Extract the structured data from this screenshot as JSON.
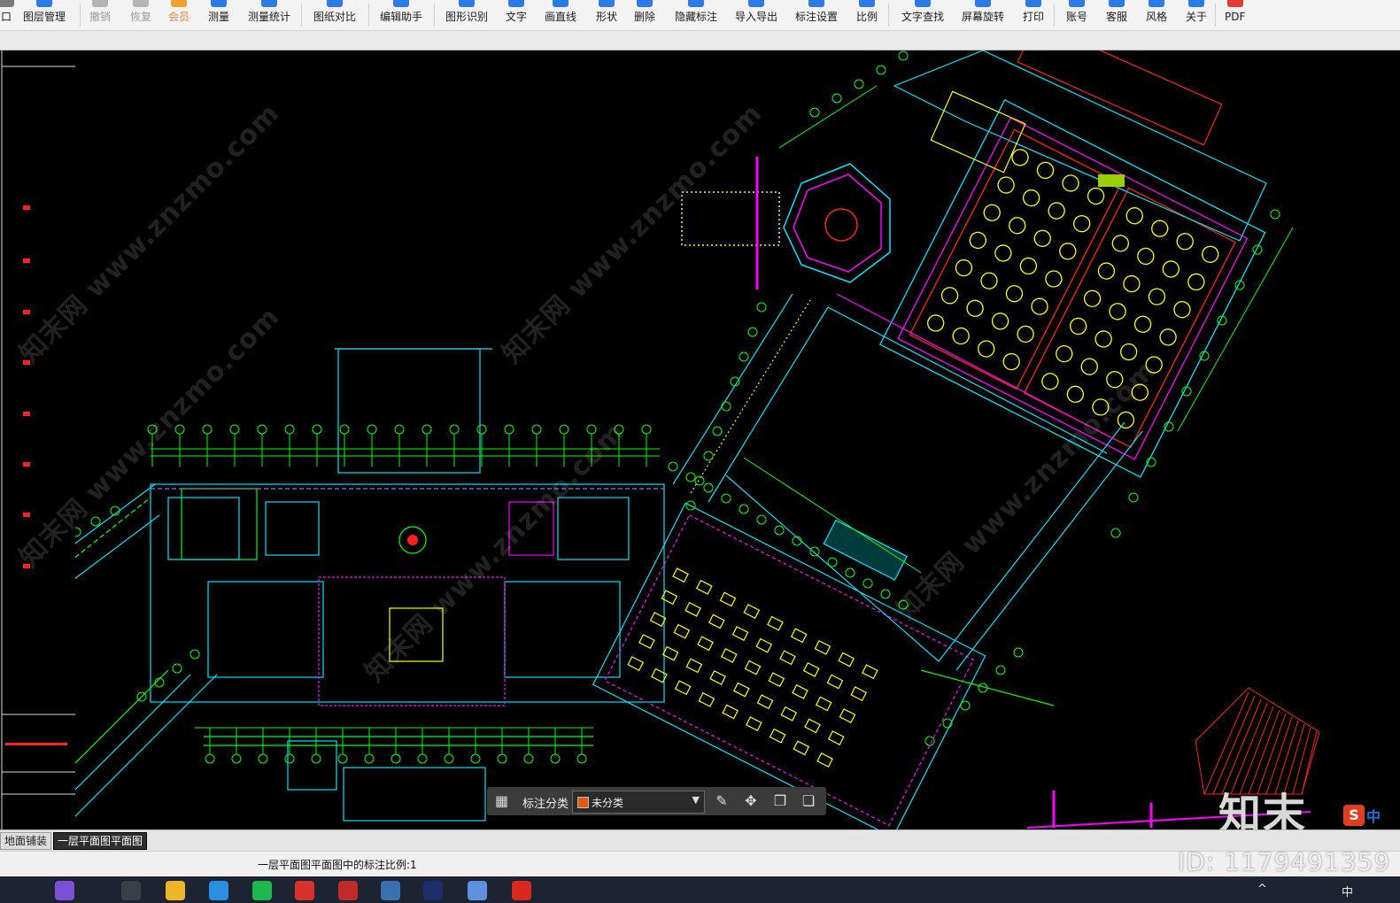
{
  "toolbar": {
    "items": [
      {
        "label": "口",
        "state": "normal"
      },
      {
        "label": "图层管理",
        "state": "normal"
      },
      {
        "label": "撤销",
        "state": "disabled"
      },
      {
        "label": "恢复",
        "state": "disabled"
      },
      {
        "label": "会员",
        "state": "accent"
      },
      {
        "label": "测量",
        "state": "normal"
      },
      {
        "label": "测量统计",
        "state": "normal"
      },
      {
        "label": "图纸对比",
        "state": "normal"
      },
      {
        "label": "编辑助手",
        "state": "normal"
      },
      {
        "label": "图形识别",
        "state": "normal"
      },
      {
        "label": "文字",
        "state": "normal"
      },
      {
        "label": "画直线",
        "state": "normal"
      },
      {
        "label": "形状",
        "state": "normal"
      },
      {
        "label": "删除",
        "state": "normal"
      },
      {
        "label": "隐藏标注",
        "state": "normal"
      },
      {
        "label": "导入导出",
        "state": "normal"
      },
      {
        "label": "标注设置",
        "state": "normal"
      },
      {
        "label": "比例",
        "state": "normal"
      },
      {
        "label": "文字查找",
        "state": "normal"
      },
      {
        "label": "屏幕旋转",
        "state": "normal"
      },
      {
        "label": "打印",
        "state": "normal"
      },
      {
        "label": "账号",
        "state": "normal"
      },
      {
        "label": "客服",
        "state": "normal"
      },
      {
        "label": "风格",
        "state": "normal"
      },
      {
        "label": "关于",
        "state": "normal"
      },
      {
        "label": "PDF",
        "state": "normal"
      }
    ],
    "icons": [
      "window-icon",
      "layers-icon",
      "undo-icon",
      "redo-icon",
      "vip-icon",
      "ruler-icon",
      "measure-stats-icon",
      "compare-icon",
      "edit-helper-icon",
      "shape-recognize-icon",
      "text-icon",
      "line-icon",
      "shape-icon",
      "delete-icon",
      "hide-annotation-icon",
      "import-export-icon",
      "annotation-settings-icon",
      "scale-icon",
      "text-search-icon",
      "screen-rotate-icon",
      "print-icon",
      "account-icon",
      "support-icon",
      "theme-icon",
      "about-icon",
      "pdf-icon"
    ]
  },
  "colors": {
    "accent": "#e8863a",
    "cad_green": "#00ff00",
    "cad_cyan": "#00e5ff",
    "cad_yellow": "#ffff00",
    "cad_magenta": "#ff00ff",
    "cad_red": "#ff2020",
    "annotation_swatch": "#e55a13"
  },
  "watermarks": [
    "知末网 www.znzmo.com",
    "知末网 www.znzmo.com",
    "知末网 www.znzmo.com",
    "知末网 www.znzmo.com",
    "知末网 www.znzmo.com"
  ],
  "annotation_bar": {
    "label": "标注分类",
    "selected": "未分类",
    "icons": [
      "grid-icon",
      "edit-icon",
      "move-icon",
      "copy-icon",
      "paste-icon",
      "dropdown-icon"
    ]
  },
  "brand": {
    "logo_text": "知末",
    "ime_label": "中"
  },
  "tabs": [
    {
      "label": "地面铺装",
      "active": false
    },
    {
      "label": "一层平面图平面图",
      "active": true
    }
  ],
  "status": {
    "text": "一层平面图平面图中的标注比例:1"
  },
  "id_watermark": "ID: 1179491359",
  "taskbar": {
    "icons": [
      "library-icon",
      "task-view-icon",
      "explorer-icon",
      "edge-icon",
      "wechat-icon",
      "sketchup-icon",
      "autocad-icon",
      "cad-viewer-icon",
      "photoshop-icon",
      "teams-icon",
      "wps-icon"
    ],
    "tray": [
      "^",
      "中"
    ]
  }
}
